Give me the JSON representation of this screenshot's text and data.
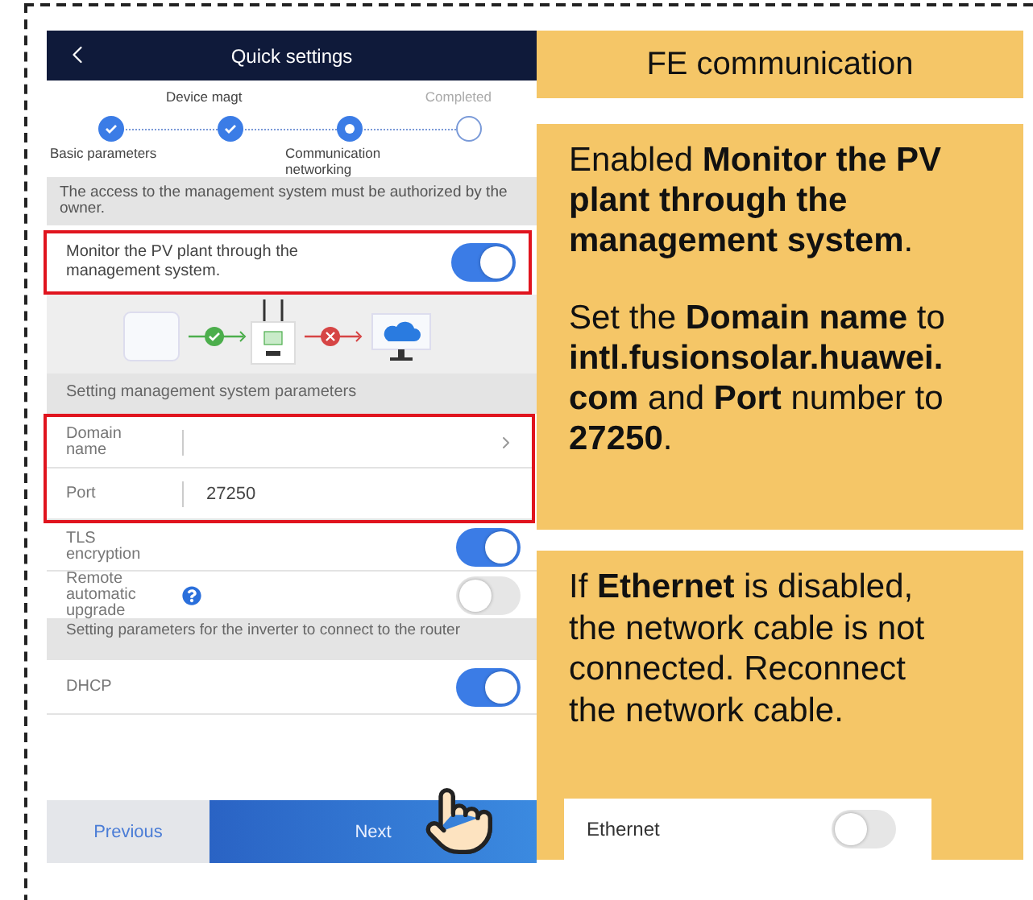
{
  "phone": {
    "title": "Quick settings",
    "steps": [
      {
        "label": "Basic parameters",
        "kind": "done"
      },
      {
        "label": "Device magt",
        "kind": "done"
      },
      {
        "label": "Communication networking",
        "kind": "current"
      },
      {
        "label": "Completed",
        "kind": "pending"
      }
    ],
    "notice": "The access to the management system must be authorized by the owner.",
    "monitor": {
      "label": "Monitor the PV plant through the management system.",
      "on": true
    },
    "section_1": "Setting management system parameters",
    "rows_1": [
      {
        "kind": "select",
        "label": "Domain name"
      },
      {
        "kind": "input",
        "label": "Port",
        "value": "27250"
      }
    ],
    "rows_2": [
      {
        "kind": "toggle",
        "label": "TLS encryption",
        "on": true,
        "help": false
      },
      {
        "kind": "toggle",
        "label": "Remote automatic upgrade",
        "on": false,
        "help": true
      }
    ],
    "section_2": "Setting parameters for the inverter to connect to the router",
    "rows_3": [
      {
        "kind": "toggle",
        "label": "DHCP",
        "on": true,
        "help": false
      }
    ],
    "buttons": [
      {
        "label": "Previous",
        "kind": "secondary"
      },
      {
        "label": "Next",
        "kind": "primary"
      }
    ]
  },
  "callouts": {
    "title": "FE communication",
    "steps_note": [
      "Enabled **Monitor the PV plant through the management system**.",
      "Set the **Domain name** to **intl.fusionsolar.huawei.com** and **Port** number to **27250**."
    ],
    "ethernet_note": "If **Ethernet** is disabled, the network cable is not connected. Reconnect the network cable.",
    "ethernet": {
      "label": "Ethernet",
      "on": false
    }
  }
}
